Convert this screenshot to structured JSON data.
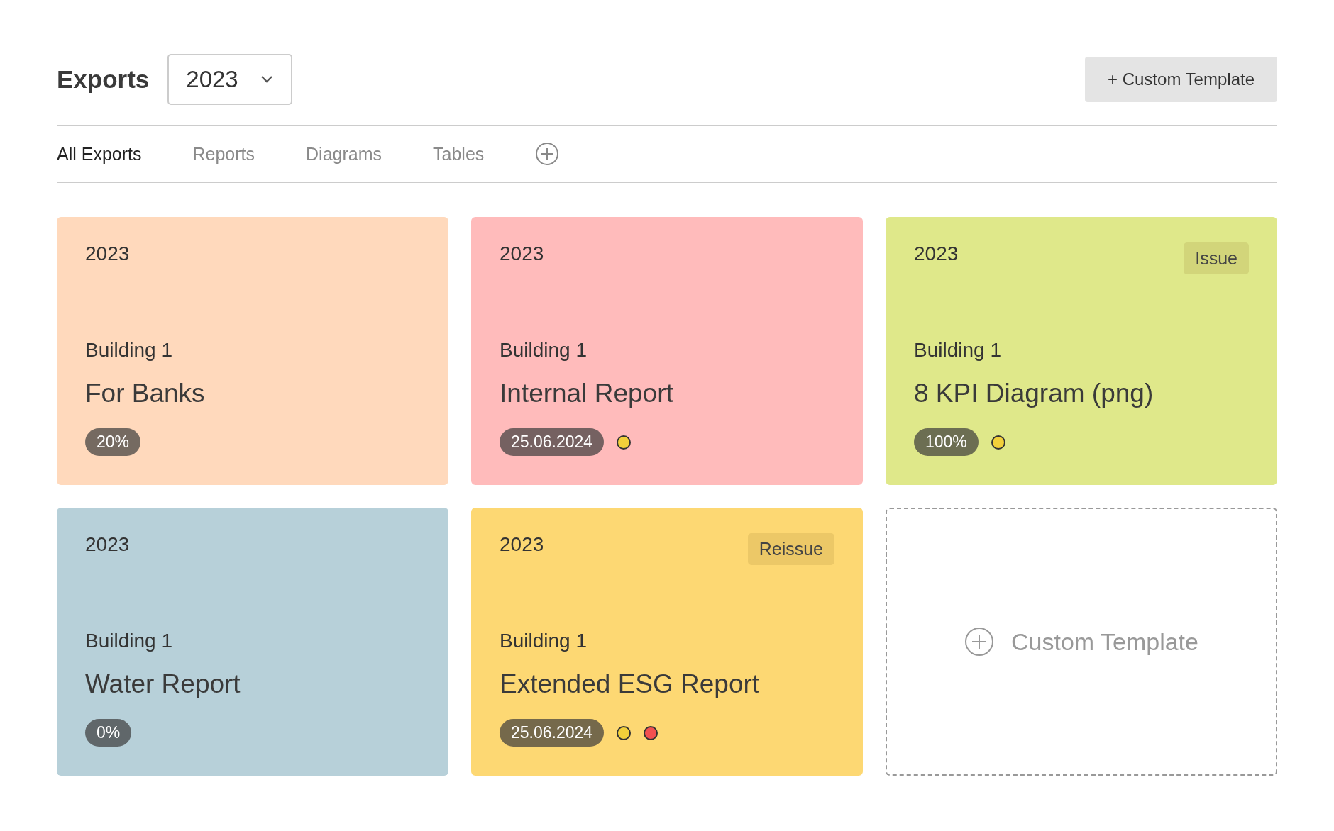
{
  "header": {
    "title": "Exports",
    "year_select": {
      "value": "2023"
    },
    "add_button": "+ Custom Template"
  },
  "tabs": [
    {
      "label": "All Exports",
      "selected": true
    },
    {
      "label": "Reports",
      "selected": false
    },
    {
      "label": "Diagrams",
      "selected": false
    },
    {
      "label": "Tables",
      "selected": false
    }
  ],
  "cards": [
    {
      "year": "2023",
      "building": "Building 1",
      "title": "For Banks",
      "badge": "20%",
      "color": "#ffd9bc"
    },
    {
      "year": "2023",
      "building": "Building 1",
      "title": "Internal Report",
      "badge": "25.06.2024",
      "color": "#ffbbbb",
      "dots": [
        {
          "color": "#f2d03a"
        }
      ]
    },
    {
      "year": "2023",
      "building": "Building 1",
      "title": "8 KPI Diagram (png)",
      "badge": "100%",
      "color": "#dfe88a",
      "tag": "Issue",
      "dots": [
        {
          "color": "#f2d03a"
        }
      ]
    },
    {
      "year": "2023",
      "building": "Building 1",
      "title": "Water Report",
      "badge": "0%",
      "color": "#b7d0d9"
    },
    {
      "year": "2023",
      "building": "Building 1",
      "title": "Extended ESG Report",
      "badge": "25.06.2024",
      "color": "#fdd873",
      "tag": "Reissue",
      "dots": [
        {
          "color": "#f2d03a"
        },
        {
          "color": "#f25050"
        }
      ]
    }
  ],
  "new_card": {
    "label": "Custom Template"
  }
}
